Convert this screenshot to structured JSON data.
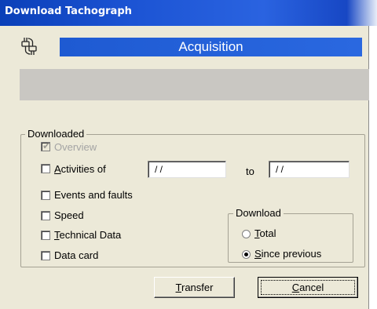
{
  "window": {
    "title": "Download Tachograph"
  },
  "header": {
    "icon": "tachograph-plug-icon",
    "title": "Acquisition"
  },
  "downloaded_group": {
    "legend": "Downloaded",
    "overview": {
      "label": "Overview",
      "checked": true,
      "disabled": true
    },
    "activities": {
      "label_prefix": "",
      "mnemonic": "A",
      "label_rest": "ctivities of",
      "checked": false
    },
    "date_from": {
      "value": " / /"
    },
    "date_to_label": "to",
    "date_to": {
      "value": " / /"
    },
    "events": {
      "label": "Events and faults",
      "checked": false
    },
    "speed": {
      "label": "Speed",
      "checked": false
    },
    "technical": {
      "mnemonic": "T",
      "label_rest": "echnical Data",
      "checked": false
    },
    "data_card": {
      "label": "Data card",
      "checked": false
    }
  },
  "download_group": {
    "legend": "Download",
    "total": {
      "mnemonic": "T",
      "label_rest": "otal",
      "selected": false
    },
    "since_previous": {
      "mnemonic": "S",
      "label_rest": "ince previous",
      "selected": true
    }
  },
  "buttons": {
    "transfer": {
      "mnemonic": "T",
      "label_rest": "ransfer"
    },
    "cancel": {
      "mnemonic": "C",
      "label_rest": "ancel"
    }
  },
  "colors": {
    "title_bar": "#1c54d4",
    "header_bar": "#2a62dc",
    "dialog_bg": "#ece9d8",
    "grey_panel": "#c9c7c2"
  }
}
